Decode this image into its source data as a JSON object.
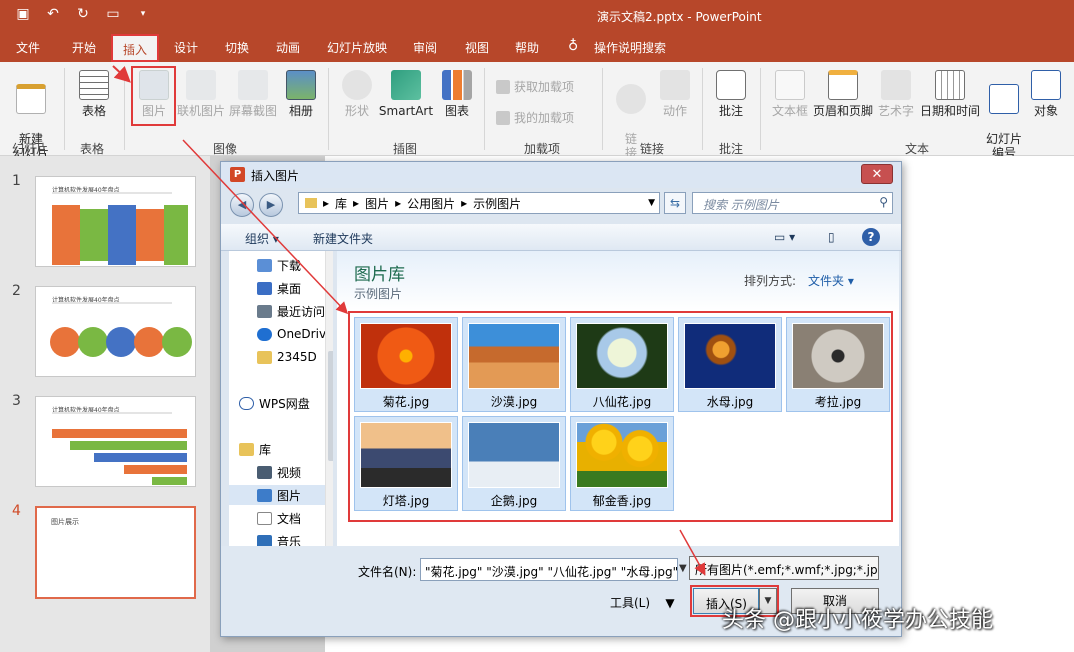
{
  "window": {
    "title": "演示文稿2.pptx  -  PowerPoint"
  },
  "tabs": [
    "文件",
    "开始",
    "插入",
    "设计",
    "切换",
    "动画",
    "幻灯片放映",
    "审阅",
    "视图",
    "帮助"
  ],
  "tell_me": "操作说明搜索",
  "ribbon": {
    "new_slide": "新建\n幻灯片",
    "table": "表格",
    "picture": "图片",
    "online_picture": "联机图片",
    "screenshot": "屏幕截图",
    "album": "相册",
    "shapes": "形状",
    "smartart": "SmartArt",
    "chart": "图表",
    "get_addins": "获取加载项",
    "my_addins": "我的加载项",
    "link": "链\n接",
    "action": "动作",
    "comment": "批注",
    "textbox": "文本框",
    "header_footer": "页眉和页脚",
    "wordart": "艺术字",
    "datetime": "日期和时间",
    "slide_number": "幻灯片\n编号",
    "object": "对象",
    "groups": {
      "slides": "幻灯片",
      "tables": "表格",
      "images": "图像",
      "illustrations": "插图",
      "addins": "加载项",
      "links": "链接",
      "comments": "批注",
      "text": "文本"
    }
  },
  "slides": [
    {
      "num": "1",
      "title": "计算机软件发展40年盘点"
    },
    {
      "num": "2",
      "title": "计算机软件发展40年盘点"
    },
    {
      "num": "3",
      "title": "计算机软件发展40年盘点"
    },
    {
      "num": "4",
      "title": "图片展示"
    }
  ],
  "dialog": {
    "title": "插入图片",
    "breadcrumb": [
      "库",
      "图片",
      "公用图片",
      "示例图片"
    ],
    "search_placeholder": "搜索 示例图片",
    "organize": "组织 ▾",
    "new_folder": "新建文件夹",
    "nav": [
      "下载",
      "桌面",
      "最近访问",
      "OneDrive",
      "2345D",
      "WPS网盘",
      "库",
      "视频",
      "图片",
      "文档",
      "音乐"
    ],
    "library_title": "图片库",
    "library_sub": "示例图片",
    "arrange_label": "排列方式:",
    "arrange_value": "文件夹 ▾",
    "files": [
      "菊花.jpg",
      "沙漠.jpg",
      "八仙花.jpg",
      "水母.jpg",
      "考拉.jpg",
      "灯塔.jpg",
      "企鹅.jpg",
      "郁金香.jpg"
    ],
    "filename_label": "文件名(N):",
    "filename_value": "\"菊花.jpg\" \"沙漠.jpg\" \"八仙花.jpg\" \"水母.jpg\" \"考拉.jpg\"",
    "filter": "所有图片(*.emf;*.wmf;*.jpg;*.jpeg)",
    "tools": "工具(L)",
    "insert": "插入(S)",
    "cancel": "取消"
  },
  "watermark": "头条 @跟小小筱学办公技能",
  "colors": {
    "accent": "#b7472a",
    "highlight": "#e03a3a"
  }
}
